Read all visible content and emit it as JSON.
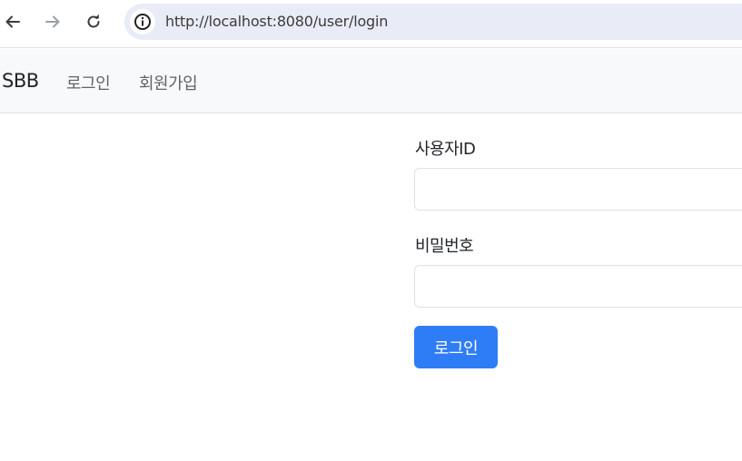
{
  "browser": {
    "url": "http://localhost:8080/user/login",
    "back_icon": "arrow-left-icon",
    "forward_icon": "arrow-right-icon",
    "reload_icon": "reload-icon",
    "info_icon": "info-icon"
  },
  "navbar": {
    "brand": "SBB",
    "links": [
      {
        "label": "로그인"
      },
      {
        "label": "회원가입"
      }
    ]
  },
  "form": {
    "userid_label": "사용자ID",
    "userid_value": "",
    "password_label": "비밀번호",
    "password_value": "",
    "submit_label": "로그인"
  },
  "colors": {
    "primary": "#2f7df6",
    "navbar_bg": "#f8f9fa",
    "url_bar_bg": "#e9ebf6"
  }
}
